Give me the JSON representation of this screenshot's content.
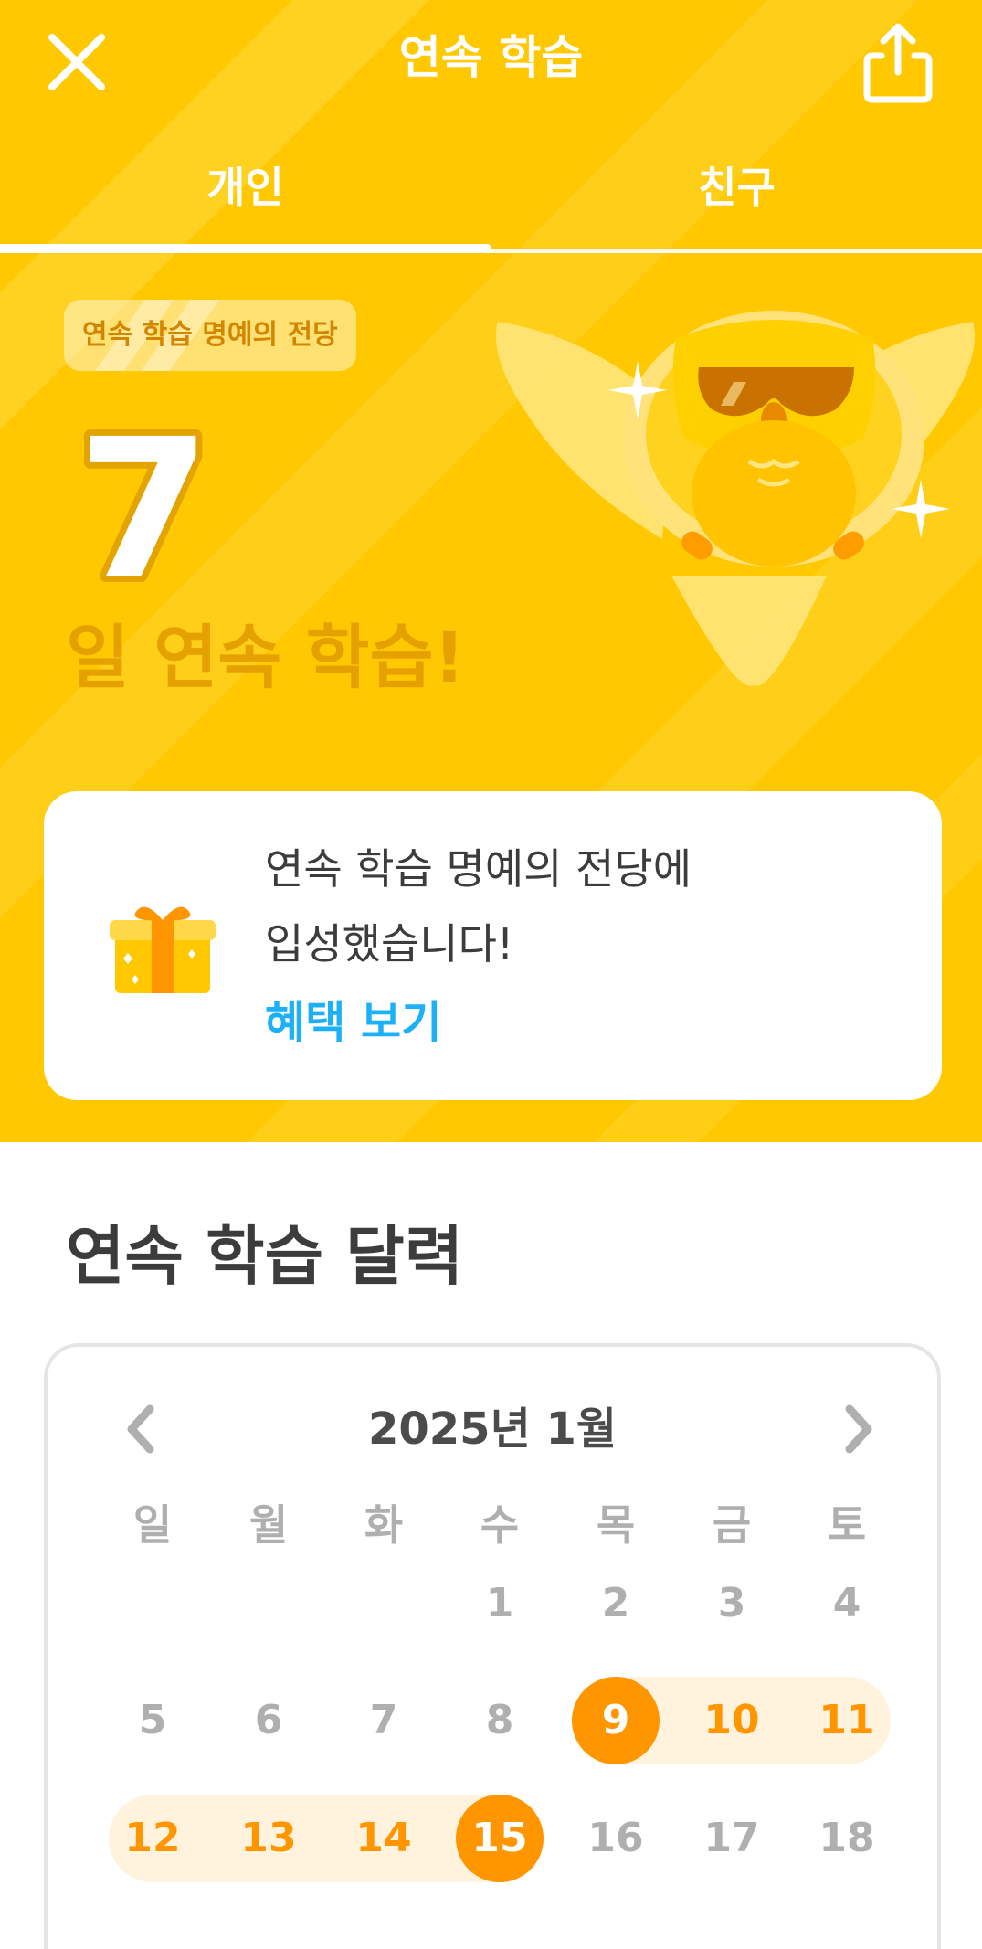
{
  "header": {
    "title": "연속 학습",
    "close_icon": "close-icon",
    "share_icon": "share-icon"
  },
  "tabs": [
    {
      "label": "개인",
      "active": true
    },
    {
      "label": "친구",
      "active": false
    }
  ],
  "hero": {
    "badge_label": "연속 학습 명예의 전당",
    "streak_count": "7",
    "streak_caption": "일 연속 학습!",
    "mascot_icon": "owl-with-sunglasses-icon"
  },
  "reward_card": {
    "gift_icon": "gift-icon",
    "message_line1": "연속 학습 명예의 전당에",
    "message_line2": "입성했습니다!",
    "link_label": "혜택 보기"
  },
  "calendar": {
    "section_title": "연속 학습 달력",
    "month_label": "2025년 1월",
    "prev_icon": "chevron-left-icon",
    "next_icon": "chevron-right-icon",
    "weekdays": [
      "일",
      "월",
      "화",
      "수",
      "목",
      "금",
      "토"
    ],
    "weeks": [
      [
        null,
        null,
        null,
        "1",
        "2",
        "3",
        "4"
      ],
      [
        "5",
        "6",
        "7",
        "8",
        "9",
        "10",
        "11"
      ],
      [
        "12",
        "13",
        "14",
        "15",
        "16",
        "17",
        "18"
      ]
    ],
    "streak_start_day": "9",
    "streak_end_day": "15",
    "streak_days": [
      "9",
      "10",
      "11",
      "12",
      "13",
      "14",
      "15"
    ]
  },
  "colors": {
    "hero_yellow": "#ffc800",
    "streak_orange": "#ff9600",
    "streak_highlight": "#fff3de",
    "link_blue": "#1cb0f6",
    "text_dark": "#3c3c3c",
    "text_muted": "#afafaf"
  }
}
